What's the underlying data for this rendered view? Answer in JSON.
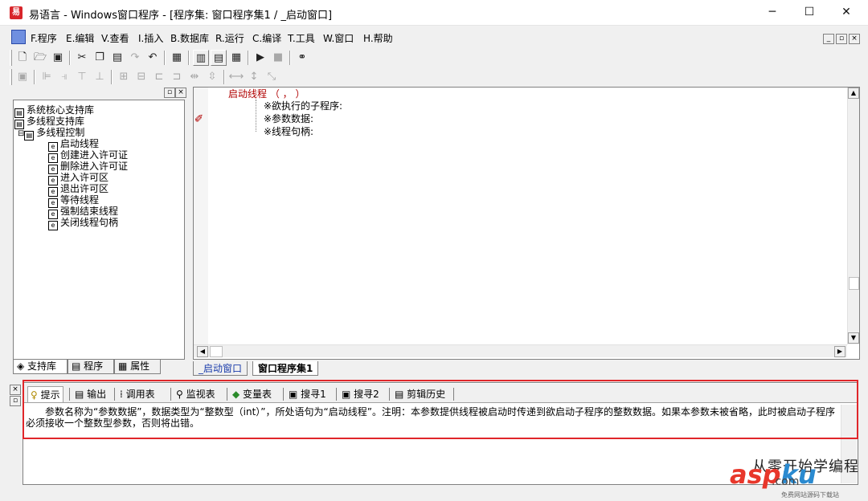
{
  "window": {
    "title": "易语言 - Windows窗口程序 - [程序集: 窗口程序集1 / _启动窗口]",
    "minimize": "─",
    "maximize": "☐",
    "close": "✕"
  },
  "menu": {
    "items": [
      "F.程序",
      "E.编辑",
      "V.查看",
      "I.插入",
      "B.数据库",
      "R.运行",
      "C.编译",
      "T.工具",
      "W.窗口",
      "H.帮助"
    ],
    "mdi_min": "_",
    "mdi_restore": "▫",
    "mdi_close": "×"
  },
  "left_panel": {
    "pin": "▫",
    "close": "×",
    "tree": [
      {
        "label": "系统核心支持库",
        "indent": 0
      },
      {
        "label": "多线程支持库",
        "indent": 0
      },
      {
        "label": "多线程控制",
        "indent": 1
      },
      {
        "label": "启动线程",
        "indent": 2
      },
      {
        "label": "创建进入许可证",
        "indent": 2
      },
      {
        "label": "删除进入许可证",
        "indent": 2
      },
      {
        "label": "进入许可区",
        "indent": 2
      },
      {
        "label": "退出许可区",
        "indent": 2
      },
      {
        "label": "等待线程",
        "indent": 2
      },
      {
        "label": "强制结束线程",
        "indent": 2
      },
      {
        "label": "关闭线程句柄",
        "indent": 2
      }
    ],
    "tree_expander": "⊟",
    "tabs": [
      "支持库",
      "程序",
      "属性"
    ]
  },
  "editor": {
    "code_line": "启动线程 （ ， ）",
    "params": [
      "※欲执行的子程序:",
      "※参数数据:",
      "※线程句柄:"
    ],
    "doc_tabs": [
      "_启动窗口",
      "窗口程序集1"
    ]
  },
  "bottom_panel": {
    "pin": "▫",
    "close": "×",
    "tabs": [
      "提示",
      "输出",
      "调用表",
      "监视表",
      "变量表",
      "搜寻1",
      "搜寻2",
      "剪辑历史"
    ],
    "tip": "参数名称为“参数数据”，数据类型为“整数型（int）”，所处语句为“启动线程”。注明：本参数提供线程被启动时传递到欲启动子程序的整数数据。如果本参数未被省略，此时被启动子程序必须接收一个整数型参数，否则将出错。"
  },
  "watermark": {
    "cn": "从零开始学编程",
    "asp": "asp",
    "ku": "ku",
    "url": ".com",
    "sub": "免费网站源码下载站"
  },
  "colors": {
    "highlight": "#e0262a",
    "code_keyword": "#b00000"
  }
}
